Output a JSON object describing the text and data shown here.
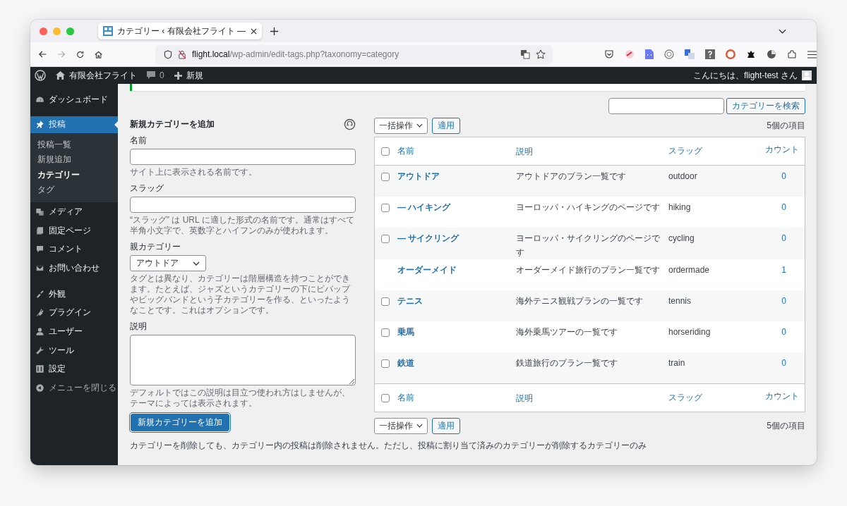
{
  "browser": {
    "tab": {
      "title": "カテゴリー ‹ 有限会社フライト —"
    },
    "address": {
      "host": "flight.local",
      "path": "/wp-admin/edit-tags.php?taxonomy=category"
    }
  },
  "admin_bar": {
    "site_name": "有限会社フライト",
    "comments": "0",
    "new": "新規",
    "greeting": "こんにちは、flight-test さん"
  },
  "sidebar": {
    "groups": [
      {
        "items": [
          {
            "kind": "menu",
            "label": "ダッシュボード",
            "selected": false
          }
        ]
      },
      {
        "items": [
          {
            "kind": "menu",
            "label": "投稿",
            "selected": true,
            "children": [
              {
                "label": "投稿一覧",
                "selected": false
              },
              {
                "label": "新規追加",
                "selected": false
              },
              {
                "label": "カテゴリー",
                "selected": true
              },
              {
                "label": "タグ",
                "selected": false
              }
            ]
          },
          {
            "kind": "menu",
            "label": "メディア",
            "selected": false
          },
          {
            "kind": "menu",
            "label": "固定ページ",
            "selected": false
          },
          {
            "kind": "menu",
            "label": "コメント",
            "selected": false
          },
          {
            "kind": "menu",
            "label": "お問い合わせ",
            "selected": false
          }
        ]
      },
      {
        "items": [
          {
            "kind": "menu",
            "label": "外観",
            "selected": false
          },
          {
            "kind": "menu",
            "label": "プラグイン",
            "selected": false
          },
          {
            "kind": "menu",
            "label": "ユーザー",
            "selected": false
          },
          {
            "kind": "menu",
            "label": "ツール",
            "selected": false
          },
          {
            "kind": "menu",
            "label": "設定",
            "selected": false
          },
          {
            "kind": "collapse",
            "label": "メニューを閉じる",
            "selected": false
          }
        ]
      }
    ]
  },
  "add_form": {
    "heading": "新規カテゴリーを追加",
    "fields": [
      {
        "kind": "text",
        "label": "名前",
        "hint": "サイト上に表示される名前です。"
      },
      {
        "kind": "text",
        "label": "スラッグ",
        "hint": "“スラッグ” は URL に適した形式の名前です。通常はすべて半角小文字で、英数字とハイフンのみが使われます。"
      },
      {
        "kind": "select",
        "label": "親カテゴリー",
        "value": "アウトドア",
        "hint": "タグとは異なり、カテゴリーは階層構造を持つことができます。たとえば、ジャズというカテゴリーの下にビバップやビッグバンドという子カテゴリーを作る、といったようなことです。これはオプションです。"
      },
      {
        "kind": "textarea",
        "label": "説明",
        "hint": "デフォルトではこの説明は目立つ使われ方はしませんが、テーマによっては表示されます。"
      }
    ],
    "submit": "新規カテゴリーを追加"
  },
  "search": {
    "button": "カテゴリーを検索"
  },
  "tablenav_top": {
    "bulk": "一括操作",
    "apply": "適用",
    "count": "5個の項目"
  },
  "table": {
    "select_all_checked": false,
    "columns": [
      "名前",
      "説明",
      "スラッグ",
      "カウント"
    ],
    "rows": [
      {
        "name": "アウトドア",
        "description": "アウトドアのプラン一覧です",
        "slug": "outdoor",
        "count": "0",
        "checkable": true,
        "checked": false
      },
      {
        "name": "— ハイキング",
        "description": "ヨーロッパ・ハイキングのページです",
        "slug": "hiking",
        "count": "0",
        "checkable": true,
        "checked": false
      },
      {
        "name": "— サイクリング",
        "description": "ヨーロッパ・サイクリングのページです",
        "slug": "cycling",
        "count": "0",
        "checkable": true,
        "checked": false
      },
      {
        "name": "オーダーメイド",
        "description": "オーダーメイド旅行のプラン一覧です",
        "slug": "ordermade",
        "count": "1",
        "checkable": false
      },
      {
        "name": "テニス",
        "description": "海外テニス観戦プランの一覧です",
        "slug": "tennis",
        "count": "0",
        "checkable": true,
        "checked": false
      },
      {
        "name": "乗馬",
        "description": "海外乗馬ツアーの一覧です",
        "slug": "horseriding",
        "count": "0",
        "checkable": true,
        "checked": false
      },
      {
        "name": "鉄道",
        "description": "鉄道旅行のプラン一覧です",
        "slug": "train",
        "count": "0",
        "checkable": true,
        "checked": false
      }
    ],
    "footer_select_all_checked": false,
    "footer_columns": [
      "名前",
      "説明",
      "スラッグ",
      "カウント"
    ]
  },
  "tablenav_bottom": {
    "bulk": "一括操作",
    "apply": "適用",
    "count": "5個の項目"
  },
  "footer_note": "カテゴリーを削除しても、カテゴリー内の投稿は削除されません。ただし、投稿に割り当て済みのカテゴリーが削除するカテゴリーのみ"
}
